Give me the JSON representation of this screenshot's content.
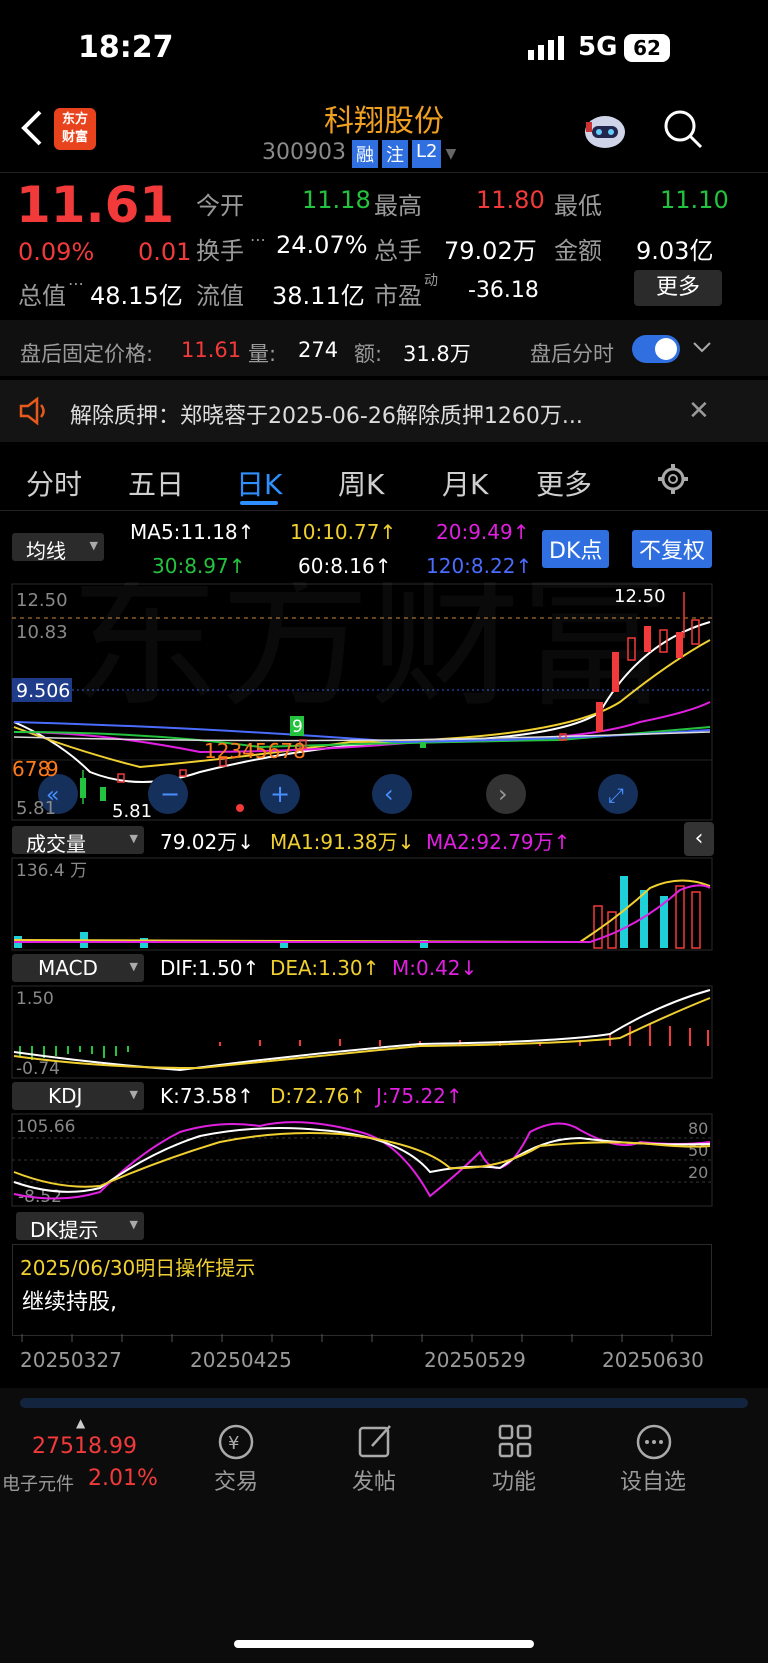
{
  "status_bar": {
    "time": "18:27",
    "network": "5G",
    "battery": "62"
  },
  "header": {
    "logo_line1": "东方",
    "logo_line2": "财富",
    "title": "科翔股份",
    "code": "300903",
    "tags": [
      "融",
      "注",
      "L2"
    ]
  },
  "quote": {
    "price": "11.61",
    "change_pct": "0.09%",
    "change": "0.01",
    "open_label": "今开",
    "open": "11.18",
    "high_label": "最高",
    "high": "11.80",
    "low_label": "最低",
    "low": "11.10",
    "turnover_label": "换手",
    "turnover": "24.07%",
    "volume_label": "总手",
    "volume": "79.02万",
    "amount_label": "金额",
    "amount": "9.03亿",
    "mcap_label": "总值",
    "mcap": "48.15亿",
    "float_label": "流值",
    "float": "38.11亿",
    "pe_label": "市盈",
    "pe_sup": "动",
    "pe": "-36.18",
    "more_label": "更多"
  },
  "after_hours": {
    "label": "盘后固定价格:",
    "price": "11.61",
    "vol_label": "量:",
    "vol": "274",
    "amt_label": "额:",
    "amt": "31.8万",
    "toggle_label": "盘后分时"
  },
  "notice": {
    "text": "解除质押：郑晓蓉于2025-06-26解除质押1260万..."
  },
  "tabs": [
    "分时",
    "五日",
    "日K",
    "周K",
    "月K",
    "更多"
  ],
  "active_tab": "日K",
  "ma": {
    "selector": "均线",
    "ma5": "MA5:11.18↑",
    "ma10": "10:10.77↑",
    "ma20": "20:9.49↑",
    "ma30": "30:8.97↑",
    "ma60": "60:8.16↑",
    "ma120": "120:8.22↑",
    "dk_btn": "DK点",
    "fq_btn": "不复权"
  },
  "kchart": {
    "y_top": "12.50",
    "y_2": "10.83",
    "y_bottom": "5.81",
    "ref": "9.506",
    "high_label": "12.50",
    "low_label": "5.81",
    "seq1": "12345678",
    "seq1b": "9",
    "seq2": "678",
    "seq2b": "9"
  },
  "volume": {
    "selector": "成交量",
    "val": "79.02万↓",
    "ma1": "MA1:91.38万↓",
    "ma2": "MA2:92.79万↑",
    "max": "136.4 万"
  },
  "macd": {
    "selector": "MACD",
    "dif": "DIF:1.50↑",
    "dea": "DEA:1.30↑",
    "m": "M:0.42↓",
    "top": "1.50",
    "bottom": "-0.74"
  },
  "kdj": {
    "selector": "KDJ",
    "k": "K:73.58↑",
    "d": "D:72.76↑",
    "j": "J:75.22↑",
    "top": "105.66",
    "bottom": "-8.52",
    "l80": "80",
    "l50": "50",
    "l20": "20"
  },
  "dk": {
    "selector": "DK提示",
    "date_line": "2025/06/30明日操作提示",
    "advice": "继续持股,"
  },
  "dates": [
    "20250327",
    "20250425",
    "20250529",
    "20250630"
  ],
  "bottom_nav": {
    "index_value": "27518.99",
    "index_name": "电子元件",
    "index_pct": "2.01%",
    "items": [
      "交易",
      "发帖",
      "功能",
      "设自选"
    ]
  },
  "colors": {
    "up": "#f23a3a",
    "down": "#24c33f",
    "accent": "#2f6fe0",
    "title": "#f0a020"
  }
}
